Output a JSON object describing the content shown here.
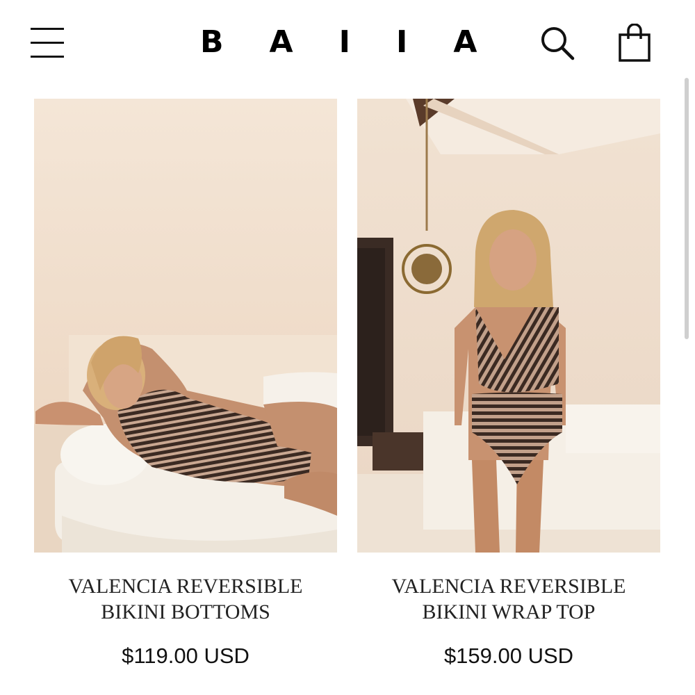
{
  "header": {
    "logo": "BAIIA",
    "icons": [
      "menu-icon",
      "search-icon",
      "shopping-bag-icon"
    ]
  },
  "products": [
    {
      "title": "VALENCIA REVERSIBLE BIKINI BOTTOMS",
      "price": "$119.00 USD"
    },
    {
      "title": "VALENCIA REVERSIBLE BIKINI WRAP TOP",
      "price": "$159.00 USD"
    }
  ],
  "colors": {
    "background": "#ffffff",
    "text": "#111111",
    "wall": "#efd9c3",
    "sofa": "#f3ede4",
    "swimsuit_stripe": "#3b2a22"
  }
}
